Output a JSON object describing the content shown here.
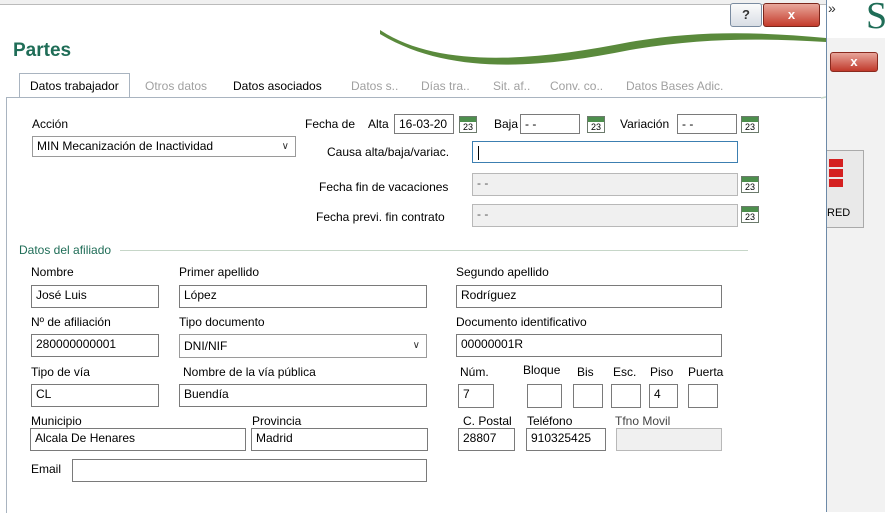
{
  "window": {
    "title": "Partes",
    "help_label": "?",
    "close_label": "x"
  },
  "background": {
    "chevron": "»",
    "letter": "S",
    "close_label": "x",
    "tool_label": "RED"
  },
  "tabs": [
    {
      "label": "Datos trabajador",
      "state": "active"
    },
    {
      "label": "Otros datos",
      "state": "disabled"
    },
    {
      "label": "Datos asociados",
      "state": "enabled"
    },
    {
      "label": "Datos s..",
      "state": "disabled"
    },
    {
      "label": "Días tra..",
      "state": "disabled"
    },
    {
      "label": "Sit. af..",
      "state": "disabled"
    },
    {
      "label": "Conv. co..",
      "state": "disabled"
    },
    {
      "label": "Datos Bases Adic.",
      "state": "disabled"
    }
  ],
  "accion": {
    "label": "Acción",
    "value": "MIN Mecanización de Inactividad"
  },
  "fechas": {
    "fecha_de_label": "Fecha de",
    "alta_label": "Alta",
    "alta_value": "16-03-20",
    "baja_label": "Baja",
    "baja_value": "- -",
    "variacion_label": "Variación",
    "variacion_value": "- -",
    "causa_label": "Causa alta/baja/variac.",
    "causa_value": "",
    "fin_vacaciones_label": "Fecha fin de vacaciones",
    "fin_vacaciones_value": "- -",
    "fin_contrato_label": "Fecha previ. fin contrato",
    "fin_contrato_value": "- -",
    "calendar_icon_text": "23"
  },
  "afiliado": {
    "section_title": "Datos del afiliado",
    "nombre_label": "Nombre",
    "nombre_value": "José Luis",
    "primer_apellido_label": "Primer apellido",
    "primer_apellido_value": "López",
    "segundo_apellido_label": "Segundo apellido",
    "segundo_apellido_value": "Rodríguez",
    "afiliacion_label": "Nº de afiliación",
    "afiliacion_value": "280000000001",
    "tipo_documento_label": "Tipo documento",
    "tipo_documento_value": "DNI/NIF",
    "documento_label": "Documento identificativo",
    "documento_value": "00000001R",
    "tipo_via_label": "Tipo de vía",
    "tipo_via_value": "CL",
    "nombre_via_label": "Nombre de la vía pública",
    "nombre_via_value": "Buendía",
    "num_label": "Núm.",
    "num_value": "7",
    "bloque_label": "Bloque",
    "bloque_value": "",
    "bis_label": "Bis",
    "bis_value": "",
    "esc_label": "Esc.",
    "esc_value": "",
    "piso_label": "Piso",
    "piso_value": "4",
    "puerta_label": "Puerta",
    "puerta_value": "",
    "municipio_label": "Municipio",
    "municipio_value": "Alcala De Henares",
    "provincia_label": "Provincia",
    "provincia_value": "Madrid",
    "cpostal_label": "C. Postal",
    "cpostal_value": "28807",
    "telefono_label": "Teléfono",
    "telefono_value": "910325425",
    "movil_label": "Tfno Movil",
    "movil_value": "",
    "email_label": "Email",
    "email_value": ""
  },
  "colors": {
    "brand_green": "#1f6d57",
    "close_red": "#c43b2b"
  }
}
